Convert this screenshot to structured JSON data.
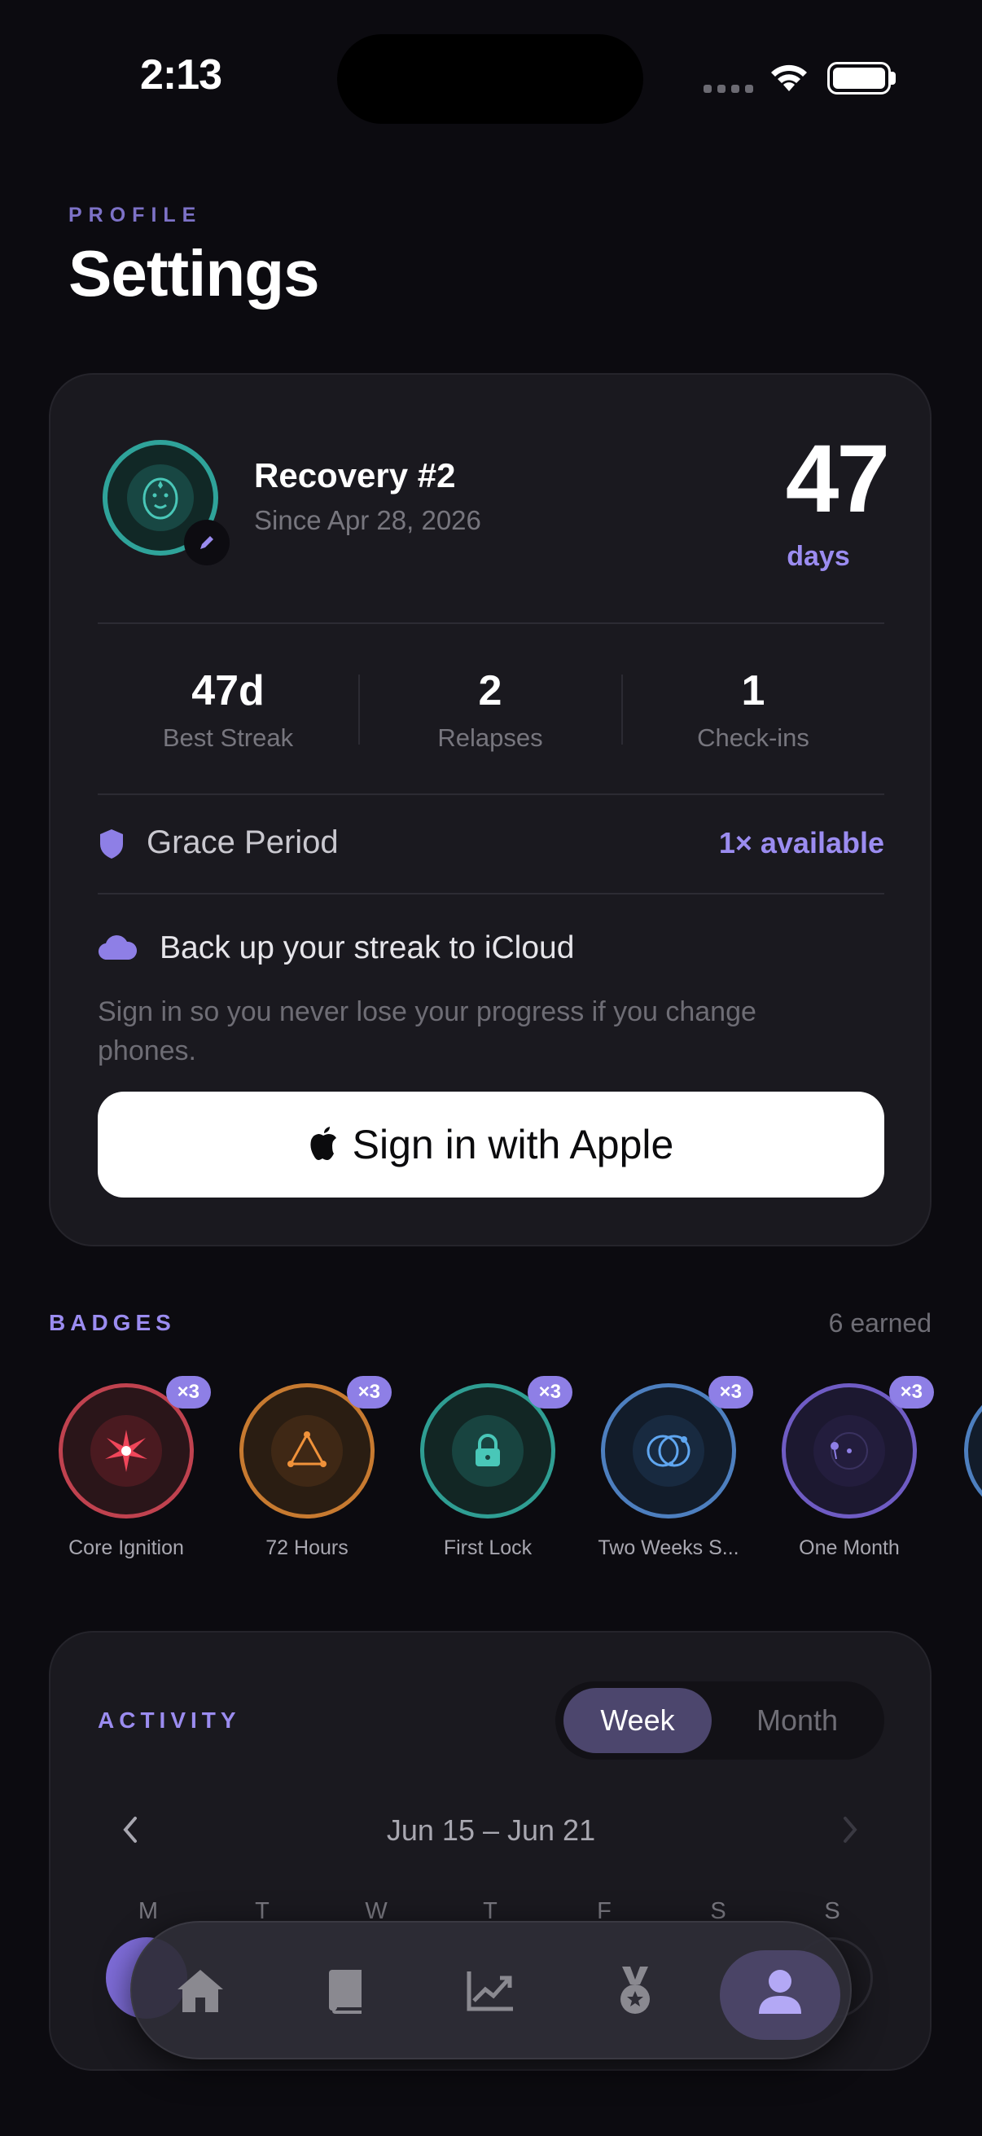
{
  "status_bar": {
    "time": "2:13"
  },
  "header": {
    "eyebrow": "PROFILE",
    "title": "Settings"
  },
  "profile": {
    "name": "Recovery #2",
    "since": "Since Apr 28, 2026",
    "days_count": "47",
    "days_label": "days",
    "stats": [
      {
        "value": "47d",
        "label": "Best Streak"
      },
      {
        "value": "2",
        "label": "Relapses"
      },
      {
        "value": "1",
        "label": "Check-ins"
      }
    ],
    "grace": {
      "label": "Grace Period",
      "value": "1× available"
    },
    "backup": {
      "title": "Back up your streak to iCloud",
      "description": "Sign in so you never lose your progress if you change phones.",
      "button": "Sign in with Apple"
    }
  },
  "badges": {
    "title": "BADGES",
    "earned": "6 earned",
    "items": [
      {
        "name": "Core Ignition",
        "count": "×3",
        "color": "#c0424f",
        "icon": "starburst-icon"
      },
      {
        "name": "72 Hours",
        "count": "×3",
        "color": "#c77a30",
        "icon": "triangle-icon"
      },
      {
        "name": "First Lock",
        "count": "×3",
        "color": "#2f9e93",
        "icon": "lock-icon"
      },
      {
        "name": "Two Weeks S...",
        "count": "×3",
        "color": "#4d7fbf",
        "icon": "orbit-icon"
      },
      {
        "name": "One Month",
        "count": "×3",
        "color": "#6f5cc4",
        "icon": "moon-orbit-icon"
      }
    ]
  },
  "activity": {
    "title": "ACTIVITY",
    "tabs": [
      "Week",
      "Month"
    ],
    "selected_tab": "Week",
    "range": "Jun 15 – Jun 21",
    "weekdays": [
      "M",
      "T",
      "W",
      "T",
      "F",
      "S",
      "S"
    ]
  },
  "tab_bar": {
    "items": [
      "home-icon",
      "book-icon",
      "chart-icon",
      "medal-icon",
      "person-icon"
    ],
    "active": "person-icon"
  },
  "colors": {
    "accent": "#9b8cf0",
    "background": "#0c0b10",
    "card": "#1a191f"
  }
}
